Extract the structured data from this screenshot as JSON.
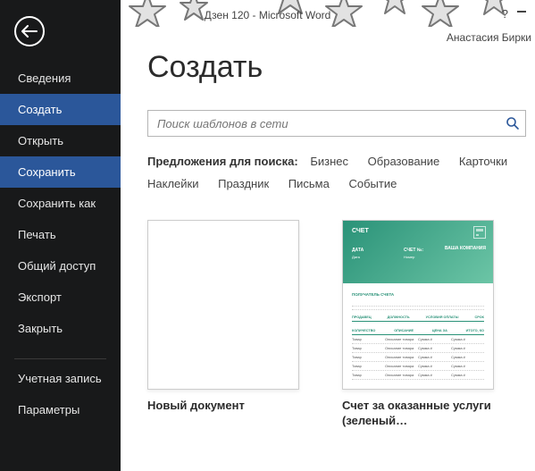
{
  "titlebar": {
    "title": "Дзен 120 - Microsoft Word",
    "help": "?",
    "username": "Анастасия Бирки"
  },
  "sidebar": {
    "items": [
      {
        "label": "Сведения"
      },
      {
        "label": "Создать"
      },
      {
        "label": "Открыть"
      },
      {
        "label": "Сохранить"
      },
      {
        "label": "Сохранить как"
      },
      {
        "label": "Печать"
      },
      {
        "label": "Общий доступ"
      },
      {
        "label": "Экспорт"
      },
      {
        "label": "Закрыть"
      }
    ],
    "footer": [
      {
        "label": "Учетная запись"
      },
      {
        "label": "Параметры"
      }
    ]
  },
  "main": {
    "title": "Создать",
    "search_placeholder": "Поиск шаблонов в сети",
    "suggest_label": "Предложения для поиска:",
    "suggest_terms": [
      "Бизнес",
      "Образование",
      "Карточки",
      "Наклейки",
      "Праздник",
      "Письма",
      "Событие"
    ],
    "templates": [
      {
        "caption": "Новый документ"
      },
      {
        "caption": "Счет за оказанные услуги (зеленый…"
      }
    ],
    "invoice_preview": {
      "title": "СЧЕТ",
      "date_lbl": "ДАТА",
      "date_val": "Дата",
      "no_lbl": "СЧЕТ №:",
      "no_val": "Номер",
      "company": "ВАША КОМПАНИЯ",
      "bill_to": "ПОЛУЧАТЕЛЬ СЧЕТА",
      "cols1": [
        "ПРОДАВЕЦ",
        "ДОЛЖНОСТЬ",
        "УСЛОВИЯ ОПЛАТЫ",
        "СРОК"
      ],
      "cols2": [
        "КОЛИЧЕСТВО",
        "ОПИСАНИЕ",
        "ЦЕНА ЗА",
        "ИТОГО, КО"
      ],
      "row": [
        "Товар",
        "Описание товара",
        "Сумма #",
        "Сумма #"
      ]
    }
  }
}
